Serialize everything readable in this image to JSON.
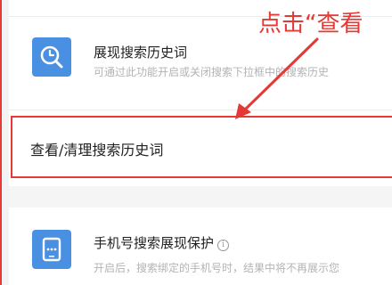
{
  "settings": {
    "search_history_display": {
      "title": "展现搜索历史词",
      "description": "可通过此功能开启或关闭搜索下拉框中的搜索历史",
      "icon": "clock-search-icon"
    },
    "view_clear_history": {
      "label": "查看/清理搜索历史词"
    },
    "phone_search_protection": {
      "title": "手机号搜索展现保护",
      "description": "开启后，搜索绑定的手机号时，结果中将不再展示您",
      "icon": "phone-lock-icon",
      "info_icon": "info-icon"
    }
  },
  "annotation": {
    "text": "点击“查看",
    "color": "#e53935"
  },
  "colors": {
    "icon_bg": "#4a90e2",
    "highlight": "#e53935"
  }
}
